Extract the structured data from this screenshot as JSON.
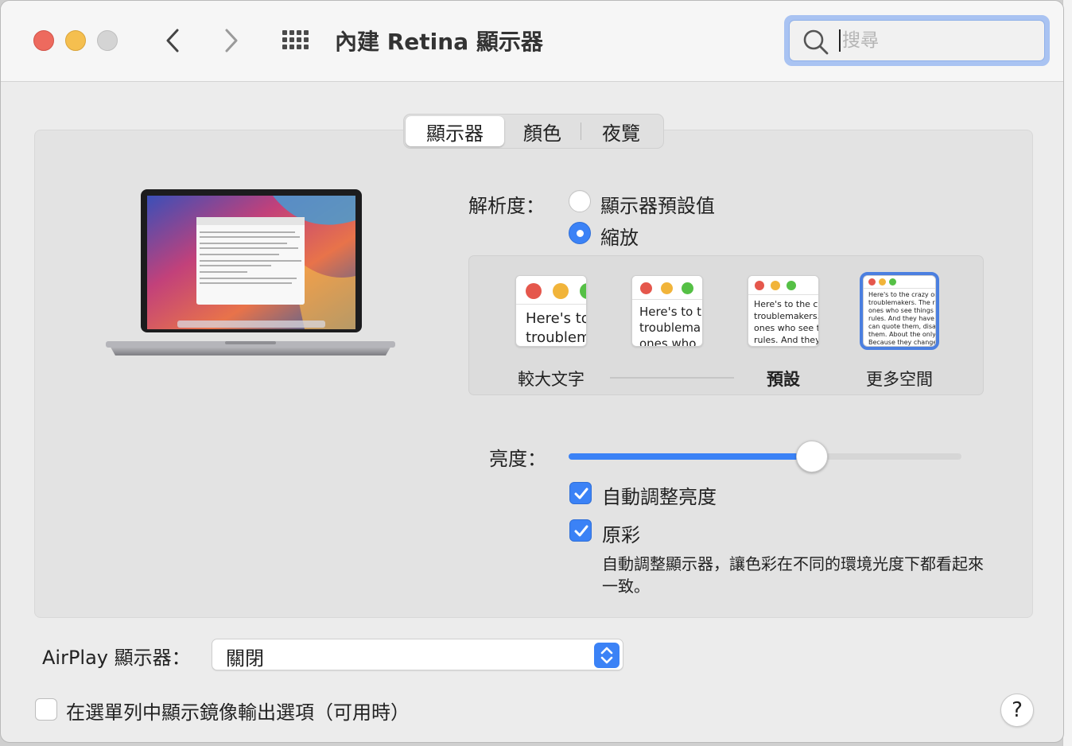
{
  "window": {
    "title": "內建 Retina 顯示器",
    "search": {
      "placeholder": "搜尋",
      "value": ""
    }
  },
  "tabs": [
    {
      "label": "顯示器",
      "active": true
    },
    {
      "label": "顏色",
      "active": false
    },
    {
      "label": "夜覽",
      "active": false
    }
  ],
  "resolution": {
    "label": "解析度：",
    "options": [
      {
        "label": "顯示器預設值",
        "selected": false
      },
      {
        "label": "縮放",
        "selected": true
      }
    ]
  },
  "scaling": {
    "thumbnails": [
      {
        "preview_text": "Here's to\ntroublem",
        "label": "較大文字",
        "selected": false
      },
      {
        "preview_text": "Here's to t\ntroublema\nones who",
        "label": "",
        "selected": false
      },
      {
        "preview_text": "Here's to the cr\ntroublemakers.\nones who see t\nrules. And they",
        "label": "預設",
        "selected": false
      },
      {
        "preview_text": "Here's to the crazy one\ntroublemakers. The rou\nones who see things dif\nrules. And they have no\ncan quote them, disagre\nthem. About the only th\nBecause they change th",
        "label": "更多空間",
        "selected": true
      }
    ]
  },
  "brightness": {
    "label": "亮度：",
    "value": 0.62,
    "auto_label": "自動調整亮度",
    "auto_checked": true
  },
  "true_tone": {
    "label": "原彩",
    "checked": true,
    "description": "自動調整顯示器，讓色彩在不同的環境光度下都看起來一致。"
  },
  "airplay": {
    "label": "AirPlay 顯示器：",
    "value": "關閉"
  },
  "mirroring": {
    "label": "在選單列中顯示鏡像輸出選項（可用時）",
    "checked": false
  },
  "help": {
    "label": "?"
  },
  "colors": {
    "accent": "#3b82f6",
    "close": "#ed6a5e",
    "minimize": "#f5bf4f",
    "zoom_disabled": "#d4d4d4"
  }
}
